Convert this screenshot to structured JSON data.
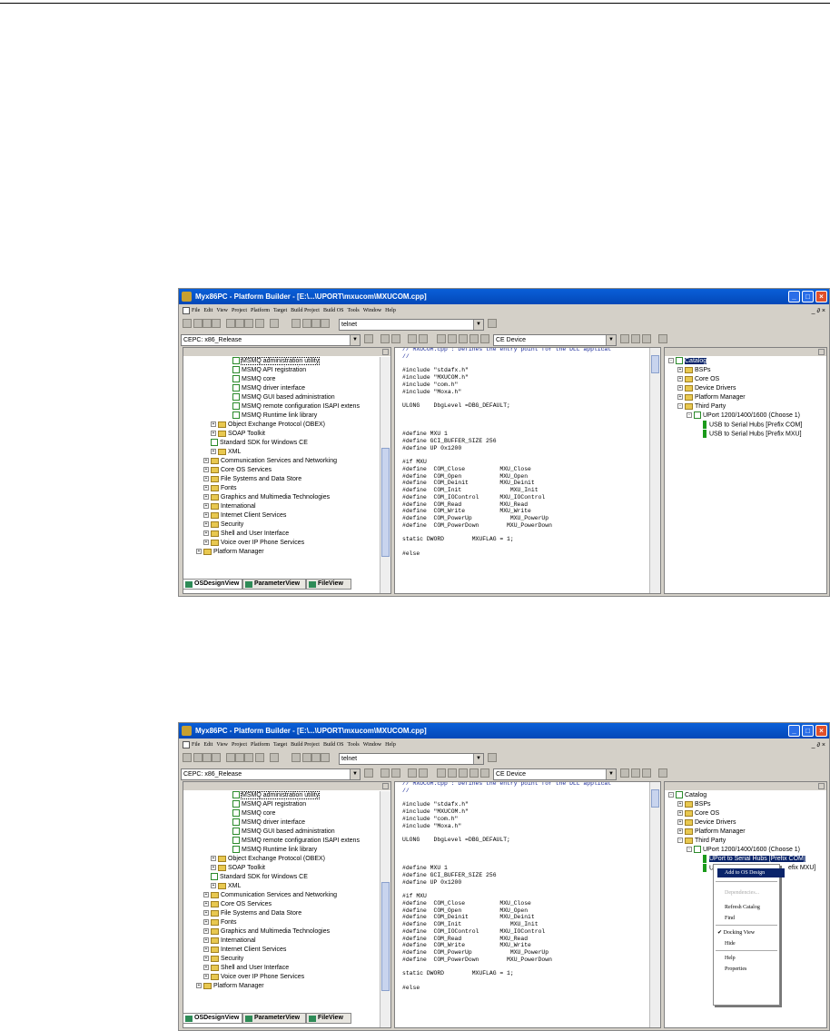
{
  "window": {
    "title": "Myx86PC - Platform Builder - [E:\\...\\UPORT\\mxucom\\MXUCOM.cpp]",
    "min_glyph": "_",
    "max_glyph": "□",
    "close_glyph": "×"
  },
  "menu": {
    "items": [
      "File",
      "Edit",
      "View",
      "Project",
      "Platform",
      "Target",
      "Build Project",
      "Build OS",
      "Tools",
      "Window",
      "Help"
    ],
    "right_controls": "_ ∂ ×"
  },
  "toolbar": {
    "find_value": "telnet",
    "config_value": "CEPC: x86_Release",
    "device_value": "CE Device",
    "dropdown_glyph": "▼"
  },
  "left_tree": [
    {
      "label": "MSMQ administration utility",
      "level": 3,
      "icon": "doc-icon",
      "boxed": true
    },
    {
      "label": "MSMQ API registration",
      "level": 3,
      "icon": "doc-icon"
    },
    {
      "label": "MSMQ core",
      "level": 3,
      "icon": "doc-icon"
    },
    {
      "label": "MSMQ driver interface",
      "level": 3,
      "icon": "doc-icon"
    },
    {
      "label": "MSMQ GUI based administration",
      "level": 3,
      "icon": "doc-icon"
    },
    {
      "label": "MSMQ remote configuration ISAPI extens",
      "level": 3,
      "icon": "doc-icon"
    },
    {
      "label": "MSMQ Runtime link library",
      "level": 3,
      "icon": "doc-icon"
    },
    {
      "label": "Object Exchange Protocol (OBEX)",
      "level": 2,
      "icon": "folder-icon",
      "expand": "+"
    },
    {
      "label": "SOAP Toolkit",
      "level": 2,
      "icon": "folder-icon",
      "expand": "+"
    },
    {
      "label": "Standard SDK for Windows CE",
      "level": 2,
      "icon": "doc-icon"
    },
    {
      "label": "XML",
      "level": 2,
      "icon": "folder-icon",
      "expand": "+"
    },
    {
      "label": "Communication Services and Networking",
      "level": 1,
      "icon": "folder-icon",
      "expand": "+"
    },
    {
      "label": "Core OS Services",
      "level": 1,
      "icon": "folder-icon",
      "expand": "+"
    },
    {
      "label": "File Systems and Data Store",
      "level": 1,
      "icon": "folder-icon",
      "expand": "+"
    },
    {
      "label": "Fonts",
      "level": 1,
      "icon": "folder-icon",
      "expand": "+"
    },
    {
      "label": "Graphics and Multimedia Technologies",
      "level": 1,
      "icon": "folder-icon",
      "expand": "+"
    },
    {
      "label": "International",
      "level": 1,
      "icon": "folder-icon",
      "expand": "+"
    },
    {
      "label": "Internet Client Services",
      "level": 1,
      "icon": "folder-icon",
      "expand": "+"
    },
    {
      "label": "Security",
      "level": 1,
      "icon": "folder-icon",
      "expand": "+"
    },
    {
      "label": "Shell and User Interface",
      "level": 1,
      "icon": "folder-icon",
      "expand": "+"
    },
    {
      "label": "Voice over IP Phone Services",
      "level": 1,
      "icon": "folder-icon",
      "expand": "+"
    },
    {
      "label": "Platform Manager",
      "level": 0,
      "icon": "folder-icon",
      "expand": "+"
    }
  ],
  "tabs": [
    "OSDesignView",
    "ParameterView",
    "FileView"
  ],
  "code_lines": [
    {
      "t": "// MXUCOM.cpp : Defines the entry point for the DLL applicat",
      "comment": true
    },
    {
      "t": "//",
      "comment": true
    },
    {
      "t": ""
    },
    {
      "t": "#include \"stdafx.h\""
    },
    {
      "t": "#include \"MXUCOM.h\""
    },
    {
      "t": "#include \"com.h\""
    },
    {
      "t": "#include \"Moxa.h\""
    },
    {
      "t": ""
    },
    {
      "t": "ULONG    DbgLevel =DBG_DEFAULT;"
    },
    {
      "t": ""
    },
    {
      "t": ""
    },
    {
      "t": ""
    },
    {
      "t": "#define MXU 1"
    },
    {
      "t": "#define GCI_BUFFER_SIZE 256"
    },
    {
      "t": "#define UP 0x1200"
    },
    {
      "t": ""
    },
    {
      "t": "#if MXU"
    },
    {
      "t": "#define  COM_Close          MXU_Close"
    },
    {
      "t": "#define  COM_Open           MXU_Open"
    },
    {
      "t": "#define  COM_Deinit         MXU_Deinit"
    },
    {
      "t": "#define  COM_Init              MXU_Init"
    },
    {
      "t": "#define  COM_IOControl      MXU_IOControl"
    },
    {
      "t": "#define  COM_Read           MXU_Read"
    },
    {
      "t": "#define  COM_Write          MXU_Write"
    },
    {
      "t": "#define  COM_PowerUp           MXU_PowerUp"
    },
    {
      "t": "#define  COM_PowerDown        MXU_PowerDown"
    },
    {
      "t": ""
    },
    {
      "t": "static DWORD        MXUFLAG = 1;"
    },
    {
      "t": ""
    },
    {
      "t": "#else"
    }
  ],
  "right_tree": [
    {
      "label": "Catalog",
      "level": 0,
      "icon": "catalog-icon",
      "expand": "-"
    },
    {
      "label": "BSPs",
      "level": 1,
      "icon": "folder-icon",
      "expand": "+"
    },
    {
      "label": "Core OS",
      "level": 1,
      "icon": "folder-icon",
      "expand": "+"
    },
    {
      "label": "Device Drivers",
      "level": 1,
      "icon": "folder-icon",
      "expand": "+"
    },
    {
      "label": "Platform Manager",
      "level": 1,
      "icon": "folder-icon",
      "expand": "+"
    },
    {
      "label": "Third Party",
      "level": 1,
      "icon": "folder-open-icon",
      "expand": "-"
    },
    {
      "label": "UPort 1200/1400/1600 (Choose 1)",
      "level": 2,
      "icon": "component-icon",
      "expand": "-"
    },
    {
      "label": "USB to Serial Hubs [Prefix COM]",
      "level": 3,
      "icon": "driver-icon"
    },
    {
      "label": "USB to Serial Hubs [Prefix MXU]",
      "level": 3,
      "icon": "driver-icon"
    }
  ],
  "shot2": {
    "row8_label": "UPort to Serial Hubs [Prefix COM]",
    "row9_left": "U",
    "row9_right": "efix MXU]"
  },
  "context_menu": [
    {
      "label": "Add to OS Design",
      "state": "highlighted"
    },
    {
      "label": "Dependencies...",
      "state": "disabled"
    },
    {
      "label": "Refresh Catalog",
      "state": "normal"
    },
    {
      "label": "Find",
      "state": "normal"
    },
    {
      "label": "Docking View",
      "state": "checked"
    },
    {
      "label": "Hide",
      "state": "normal"
    },
    {
      "label": "Help",
      "state": "normal"
    },
    {
      "label": "Properties",
      "state": "normal"
    }
  ],
  "colors": {
    "title_bar": "#0a5fd8",
    "selection": "#0a246a",
    "chrome": "#d4d0c8"
  }
}
